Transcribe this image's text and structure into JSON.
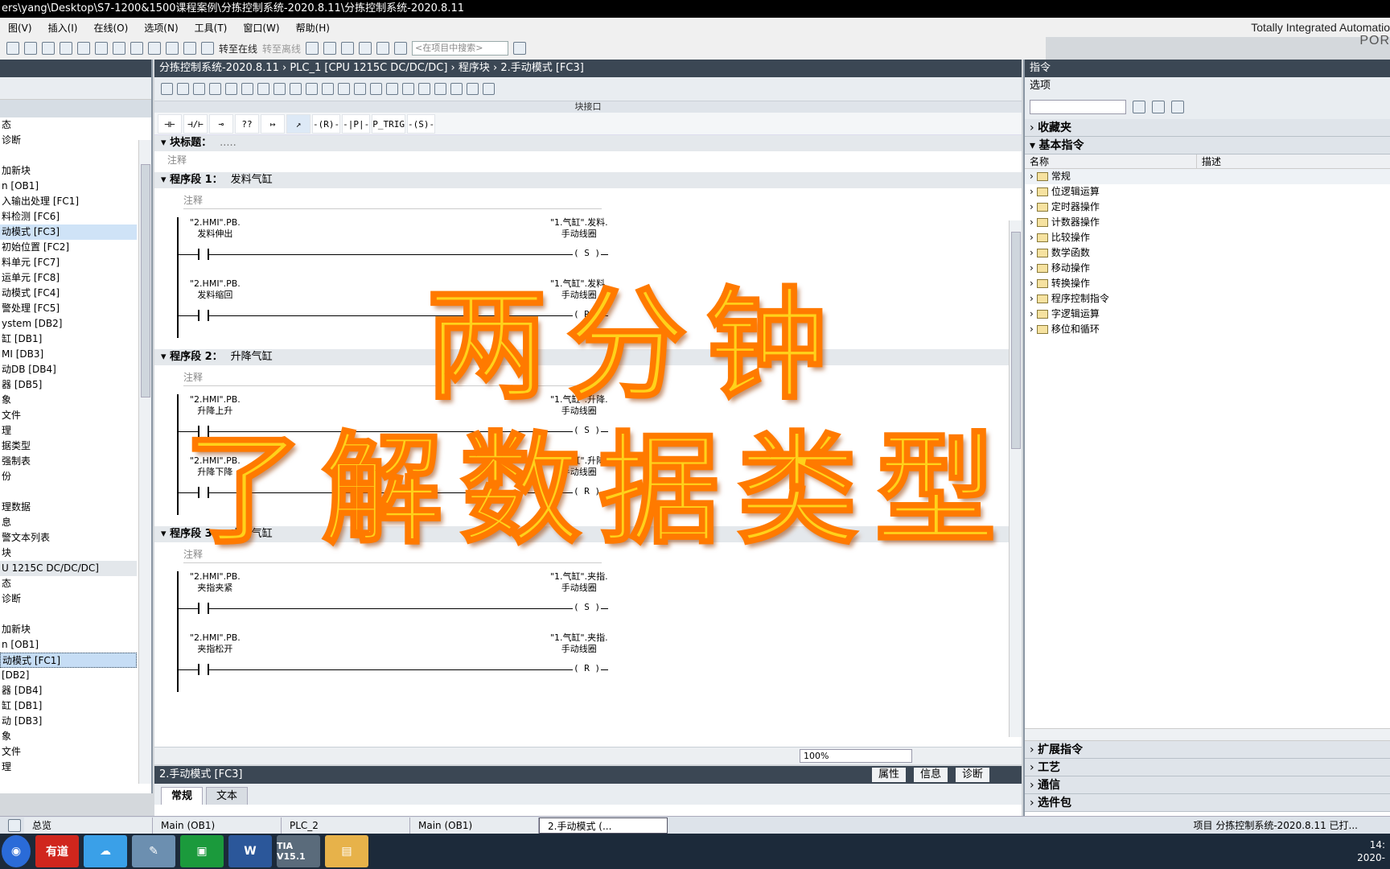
{
  "window": {
    "title": "ers\\yang\\Desktop\\S7-1200&1500课程案例\\分拣控制系统-2020.8.11\\分拣控制系统-2020.8.11"
  },
  "menu": [
    "图(V)",
    "插入(I)",
    "在线(O)",
    "选项(N)",
    "工具(T)",
    "窗口(W)",
    "帮助(H)"
  ],
  "brand": {
    "line1": "Totally Integrated Automatio",
    "line2": "POR"
  },
  "toolbar": {
    "go_online": "转至在线",
    "go_offline": "转至离线",
    "search_placeholder": "<在项目中搜索>"
  },
  "tree": [
    {
      "label": "态",
      "type": "row"
    },
    {
      "label": "诊断",
      "type": "row"
    },
    {
      "label": "",
      "type": "row"
    },
    {
      "label": "加新块",
      "type": "row"
    },
    {
      "label": "n [OB1]",
      "type": "row"
    },
    {
      "label": "入输出处理 [FC1]",
      "type": "row"
    },
    {
      "label": "料检测 [FC6]",
      "type": "row"
    },
    {
      "label": "动模式 [FC3]",
      "type": "sel"
    },
    {
      "label": "初始位置 [FC2]",
      "type": "row"
    },
    {
      "label": "料单元 [FC7]",
      "type": "row"
    },
    {
      "label": "运单元 [FC8]",
      "type": "row"
    },
    {
      "label": "动模式 [FC4]",
      "type": "row"
    },
    {
      "label": "警处理 [FC5]",
      "type": "row"
    },
    {
      "label": "ystem [DB2]",
      "type": "row"
    },
    {
      "label": "缸 [DB1]",
      "type": "row"
    },
    {
      "label": "MI [DB3]",
      "type": "row"
    },
    {
      "label": "动DB [DB4]",
      "type": "row"
    },
    {
      "label": "器 [DB5]",
      "type": "row"
    },
    {
      "label": "象",
      "type": "row"
    },
    {
      "label": "文件",
      "type": "row"
    },
    {
      "label": "理",
      "type": "row"
    },
    {
      "label": "据类型",
      "type": "row"
    },
    {
      "label": "强制表",
      "type": "row"
    },
    {
      "label": "份",
      "type": "row"
    },
    {
      "label": "",
      "type": "row"
    },
    {
      "label": "理数据",
      "type": "row"
    },
    {
      "label": "息",
      "type": "row"
    },
    {
      "label": "警文本列表",
      "type": "row"
    },
    {
      "label": "块",
      "type": "row"
    },
    {
      "label": "U 1215C DC/DC/DC]",
      "type": "sec"
    },
    {
      "label": "态",
      "type": "row"
    },
    {
      "label": "诊断",
      "type": "row"
    },
    {
      "label": "",
      "type": "row"
    },
    {
      "label": "加新块",
      "type": "row"
    },
    {
      "label": "n [OB1]",
      "type": "row"
    },
    {
      "label": "动模式 [FC1]",
      "type": "dash"
    },
    {
      "label": " [DB2]",
      "type": "row"
    },
    {
      "label": "器 [DB4]",
      "type": "row"
    },
    {
      "label": "缸 [DB1]",
      "type": "row"
    },
    {
      "label": "动 [DB3]",
      "type": "row"
    },
    {
      "label": "象",
      "type": "row"
    },
    {
      "label": "文件",
      "type": "row"
    },
    {
      "label": "理",
      "type": "row"
    }
  ],
  "editor": {
    "breadcrumb": "分拣控制系统-2020.8.11  ›  PLC_1 [CPU 1215C DC/DC/DC]  ›  程序块  ›  2.手动模式 [FC3]",
    "block_interface": "块接口",
    "ladder_tools": [
      "⊣⊢",
      "⊣/⊢",
      "⊸",
      "??",
      "↦",
      "↗",
      "-(R)-",
      "-|P|-",
      "P_TRIG",
      "-(S)-"
    ],
    "block_title": "块标题：",
    "block_title_hint": ".....",
    "block_comment": "注释",
    "networks": [
      {
        "label": "程序段 1：",
        "name": "发料气缸",
        "comment": "注释",
        "rungs": [
          {
            "in_a": "\"2.HMI\".PB.",
            "in_b": "发料伸出",
            "out_a": "\"1.气缸\".发料.",
            "out_b": "手动线圈",
            "coil": "S"
          },
          {
            "in_a": "\"2.HMI\".PB.",
            "in_b": "发料缩回",
            "out_a": "\"1.气缸\".发料.",
            "out_b": "手动线圈",
            "coil": "R"
          }
        ]
      },
      {
        "label": "程序段 2：",
        "name": "升降气缸",
        "comment": "注释",
        "rungs": [
          {
            "in_a": "\"2.HMI\".PB.",
            "in_b": "升降上升",
            "out_a": "\"1.气缸\".升降.",
            "out_b": "手动线圈",
            "coil": "S"
          },
          {
            "in_a": "\"2.HMI\".PB.",
            "in_b": "升降下降",
            "out_a": "\"1.气缸\".升降.",
            "out_b": "手动线圈",
            "coil": "R"
          }
        ]
      },
      {
        "label": "程序段 3：",
        "name": "夹指气缸",
        "comment": "注释",
        "rungs": [
          {
            "in_a": "\"2.HMI\".PB.",
            "in_b": "夹指夹紧",
            "out_a": "\"1.气缸\".夹指.",
            "out_b": "手动线圈",
            "coil": "S"
          },
          {
            "in_a": "\"2.HMI\".PB.",
            "in_b": "夹指松开",
            "out_a": "\"1.气缸\".夹指.",
            "out_b": "手动线圈",
            "coil": "R"
          }
        ]
      }
    ],
    "zoom": "100%"
  },
  "inspector": {
    "title": "2.手动模式 [FC3]",
    "buttons": [
      "属性",
      "信息",
      "诊断"
    ],
    "tabs": [
      "常规",
      "文本"
    ]
  },
  "instructions": {
    "title": "指令",
    "options": "选项",
    "favorites": "收藏夹",
    "basic": "基本指令",
    "col_name": "名称",
    "col_desc": "描述",
    "items": [
      "常规",
      "位逻辑运算",
      "定时器操作",
      "计数器操作",
      "比较操作",
      "数学函数",
      "移动操作",
      "转换操作",
      "程序控制指令",
      "字逻辑运算",
      "移位和循环"
    ],
    "sections_bottom": [
      "扩展指令",
      "工艺",
      "通信",
      "选件包"
    ]
  },
  "overlay": {
    "line1": "两分钟",
    "line2": "了解数据类型"
  },
  "taskbar": {
    "tabs": [
      "总览",
      "Main (OB1)",
      "PLC_2",
      "Main (OB1)",
      "2.手动模式 (..."
    ],
    "status": "项目 分拣控制系统-2020.8.11 已打...",
    "apps": [
      "有道",
      "W",
      "TIA V15.1"
    ],
    "clock": "14:",
    "date": "2020-"
  }
}
